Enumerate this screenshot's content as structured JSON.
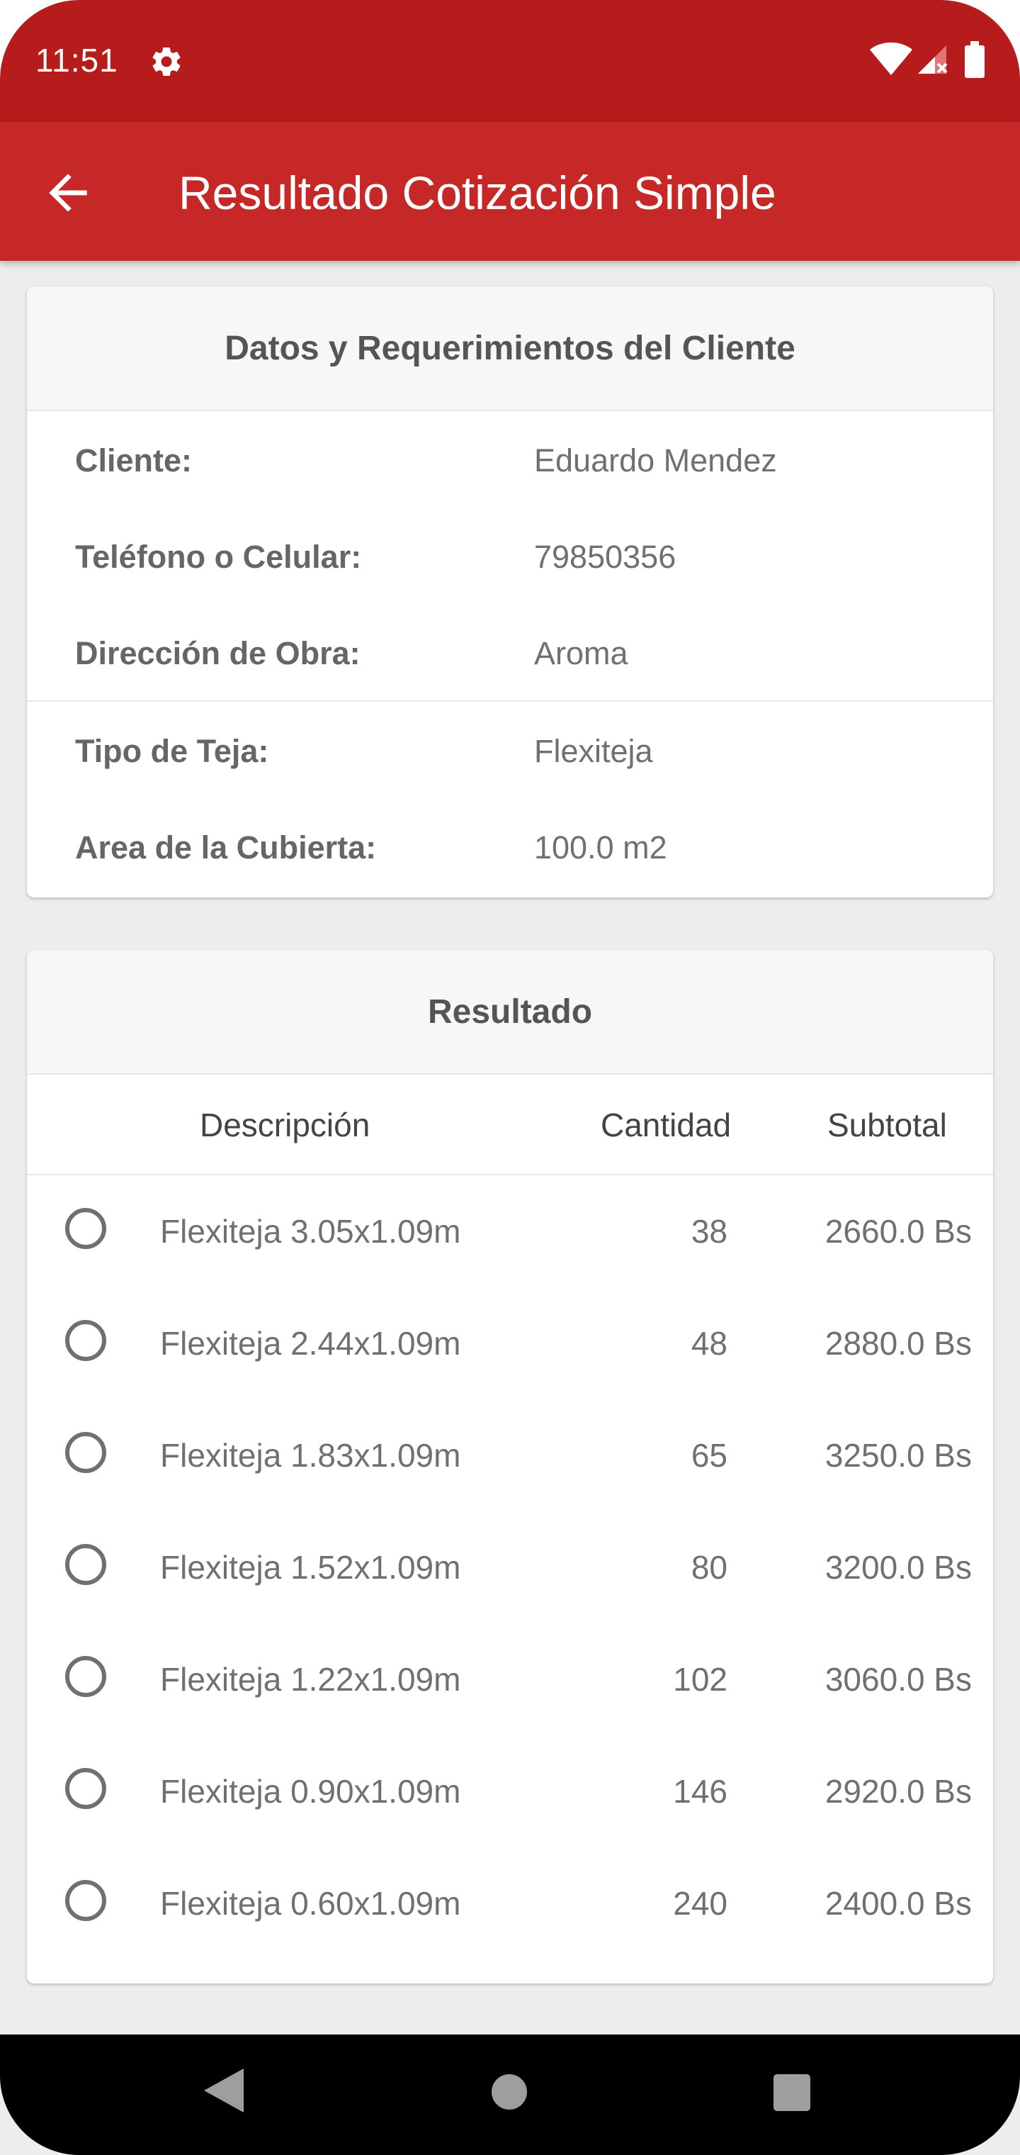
{
  "status_bar": {
    "time": "11:51",
    "icons": [
      "settings-gear-icon",
      "wifi-icon",
      "cell-signal-icon",
      "battery-icon"
    ]
  },
  "app_bar": {
    "title": "Resultado Cotización Simple",
    "back_icon": "arrow-back-icon"
  },
  "client_card": {
    "title": "Datos y Requerimientos del Cliente",
    "client_label": "Cliente:",
    "client_value": "Eduardo Mendez",
    "phone_label": "Teléfono o Celular:",
    "phone_value": "79850356",
    "address_label": "Dirección de Obra:",
    "address_value": "Aroma",
    "tile_label": "Tipo de Teja:",
    "tile_value": "Flexiteja",
    "area_label": "Area de la Cubierta:",
    "area_value": "100.0 m2"
  },
  "result_card": {
    "title": "Resultado",
    "columns": {
      "description": "Descripción",
      "quantity": "Cantidad",
      "subtotal": "Subtotal"
    },
    "items": [
      {
        "description": "Flexiteja 3.05x1.09m",
        "quantity": "38",
        "subtotal": "2660.0 Bs",
        "selected": false
      },
      {
        "description": "Flexiteja 2.44x1.09m",
        "quantity": "48",
        "subtotal": "2880.0 Bs",
        "selected": false
      },
      {
        "description": "Flexiteja 1.83x1.09m",
        "quantity": "65",
        "subtotal": "3250.0 Bs",
        "selected": false
      },
      {
        "description": "Flexiteja 1.52x1.09m",
        "quantity": "80",
        "subtotal": "3200.0 Bs",
        "selected": false
      },
      {
        "description": "Flexiteja 1.22x1.09m",
        "quantity": "102",
        "subtotal": "3060.0 Bs",
        "selected": false
      },
      {
        "description": "Flexiteja 0.90x1.09m",
        "quantity": "146",
        "subtotal": "2920.0 Bs",
        "selected": false
      },
      {
        "description": "Flexiteja 0.60x1.09m",
        "quantity": "240",
        "subtotal": "2400.0 Bs",
        "selected": false
      }
    ]
  },
  "nav_bar": {
    "icons": [
      "nav-back-icon",
      "nav-home-icon",
      "nav-recents-icon"
    ]
  },
  "colors": {
    "status_bar": "#b71c1c",
    "app_bar": "#c62828",
    "background": "#ededed"
  }
}
